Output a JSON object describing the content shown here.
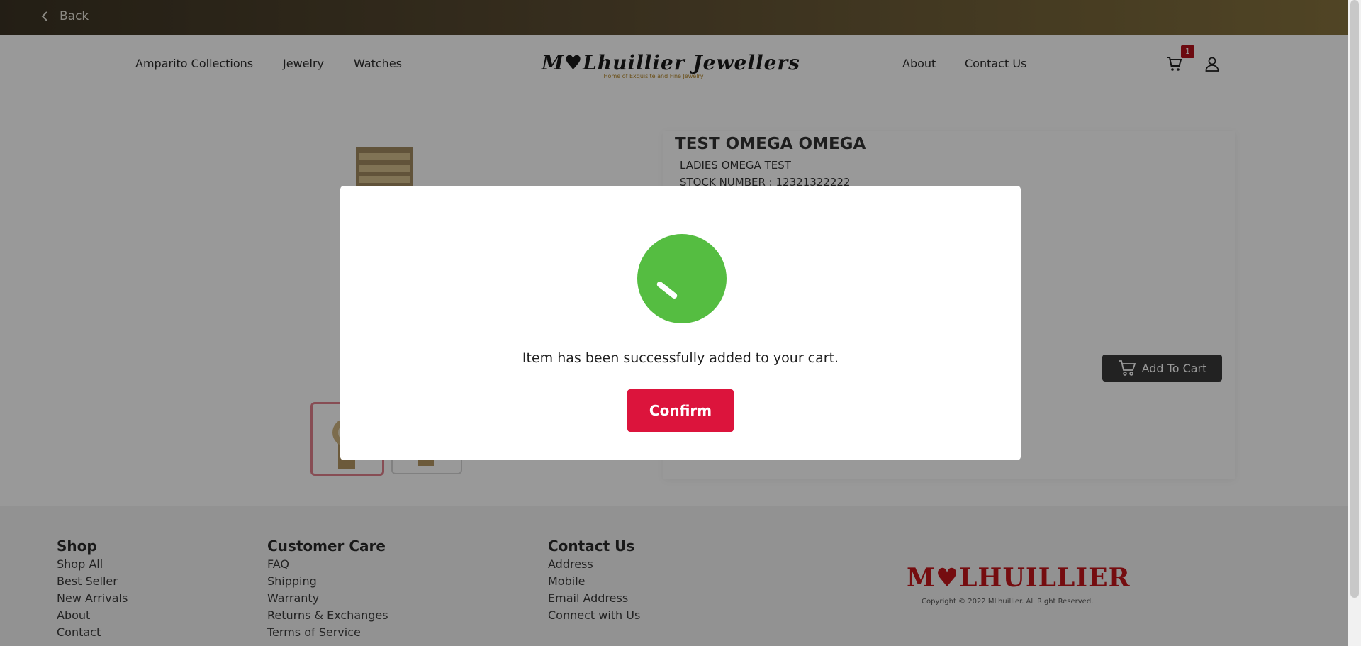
{
  "topbar": {
    "back_label": "Back"
  },
  "nav": {
    "left_links": [
      "Amparito Collections",
      "Jewelry",
      "Watches"
    ],
    "right_links": [
      "About",
      "Contact Us"
    ],
    "logo_title": "M♥Lhuillier Jewellers",
    "logo_subtitle": "Home of Exquisite and Fine Jewelry",
    "cart_count": "1"
  },
  "product": {
    "name": "TEST OMEGA OMEGA",
    "description": "LADIES OMEGA TEST",
    "stock": "STOCK NUMBER : 12321322222",
    "add_to_cart_label": "Add To Cart"
  },
  "modal": {
    "message": "Item has been successfully added to your cart.",
    "confirm_label": "Confirm",
    "accent_color": "#55bd41",
    "button_color": "#dc143c"
  },
  "footer": {
    "shop": {
      "title": "Shop",
      "links": [
        "Shop All",
        "Best Seller",
        "New Arrivals",
        "About",
        "Contact"
      ]
    },
    "care": {
      "title": "Customer Care",
      "links": [
        "FAQ",
        "Shipping",
        "Warranty",
        "Returns & Exchanges",
        "Terms of Service"
      ]
    },
    "contact": {
      "title": "Contact Us",
      "links": [
        "Address",
        "Mobile",
        "Email Address",
        "Connect with Us"
      ]
    },
    "logo": "M♥LHUILLIER",
    "copyright": "Copyright © 2022 MLhuillier. All Right Reserved."
  }
}
